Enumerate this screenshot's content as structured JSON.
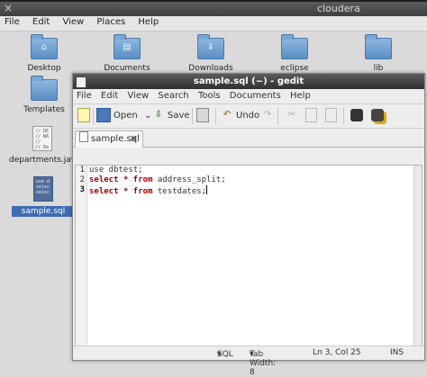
{
  "topbar": {
    "title": "cloudera",
    "close": "×"
  },
  "desktop_menu": [
    "File",
    "Edit",
    "View",
    "Places",
    "Help"
  ],
  "desktop_icons": [
    {
      "label": "Desktop"
    },
    {
      "label": "Documents"
    },
    {
      "label": "Downloads"
    },
    {
      "label": "eclipse"
    },
    {
      "label": "lib"
    },
    {
      "label": "Templates"
    },
    {
      "label": "departments.jav",
      "preview": "// DE\n// WA\n// \n// De"
    },
    {
      "label": "sample.sql",
      "preview": "use d\nselec\nselec"
    }
  ],
  "window": {
    "title": "sample.sql (~) - gedit",
    "menu": [
      "File",
      "Edit",
      "View",
      "Search",
      "Tools",
      "Documents",
      "Help"
    ],
    "toolbar": {
      "open": "Open",
      "save": "Save",
      "undo": "Undo"
    },
    "tab": {
      "label": "sample.sql",
      "close": "✕"
    },
    "lines": [
      {
        "num": "1",
        "parts": [
          {
            "t": "use dbtest;",
            "kw": false
          }
        ]
      },
      {
        "num": "2",
        "parts": [
          {
            "t": "select",
            "kw": true
          },
          {
            "t": " ",
            "kw": false
          },
          {
            "t": "*",
            "kw": true
          },
          {
            "t": " ",
            "kw": false
          },
          {
            "t": "from",
            "kw": true
          },
          {
            "t": " address_split;",
            "kw": false
          }
        ]
      },
      {
        "num": "3",
        "parts": [
          {
            "t": "select",
            "kw": true
          },
          {
            "t": " ",
            "kw": false
          },
          {
            "t": "*",
            "kw": true
          },
          {
            "t": " ",
            "kw": false
          },
          {
            "t": "from",
            "kw": true
          },
          {
            "t": " testdates;",
            "kw": false
          }
        ]
      }
    ],
    "status": {
      "language": "SQL",
      "tab_width": "Tab Width: 8",
      "position": "Ln 3, Col 25",
      "mode": "INS",
      "dropdown": "▾"
    }
  }
}
